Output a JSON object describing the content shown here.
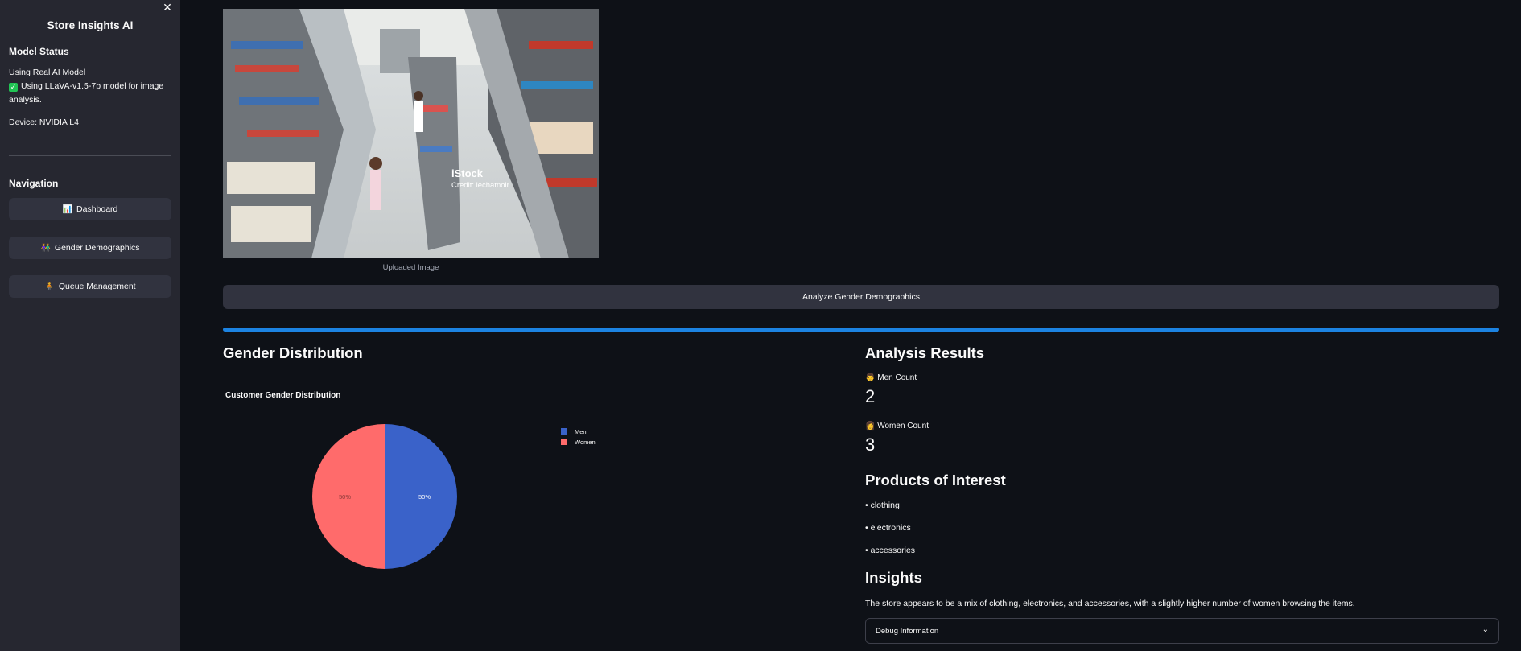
{
  "sidebar": {
    "title": "Store Insights AI",
    "model_status_heading": "Model Status",
    "model_line1": "Using Real AI Model",
    "model_line2": "Using LLaVA-v1.5-7b model for image analysis.",
    "device": "Device: NVIDIA L4",
    "navigation_heading": "Navigation",
    "nav": [
      {
        "label": "Dashboard",
        "icon": "bar-chart-icon"
      },
      {
        "label": "Gender Demographics",
        "icon": "people-icon"
      },
      {
        "label": "Queue Management",
        "icon": "person-icon"
      }
    ]
  },
  "main": {
    "image_overlay_brand": "iStock",
    "image_overlay_credit": "Credit: lechatnoir",
    "image_caption": "Uploaded Image",
    "analyze_button": "Analyze Gender Demographics",
    "progress": 1.0,
    "gender_distribution_heading": "Gender Distribution",
    "analysis_results_heading": "Analysis Results",
    "men_count_label": "Men Count",
    "men_count": "2",
    "women_count_label": "Women Count",
    "women_count": "3",
    "products_heading": "Products of Interest",
    "products": [
      "• clothing",
      "• electronics",
      "• accessories"
    ],
    "insights_heading": "Insights",
    "insight_text": "The store appears to be a mix of clothing, electronics, and accessories, with a slightly higher number of women browsing the items.",
    "debug_label": "Debug Information"
  },
  "chart_data": {
    "type": "pie",
    "title": "Customer Gender Distribution",
    "categories": [
      "Men",
      "Women"
    ],
    "values": [
      50,
      50
    ],
    "labels": [
      "50%",
      "50%"
    ],
    "colors": [
      "#3a62c9",
      "#ff6b6b"
    ],
    "legend": "right"
  }
}
